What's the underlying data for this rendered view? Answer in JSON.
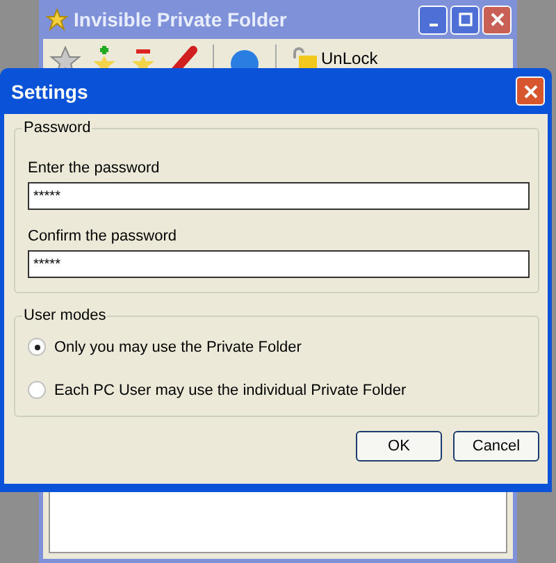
{
  "back_window": {
    "title": "Invisible Private Folder",
    "toolbar": {
      "unlock_label": "UnLock"
    }
  },
  "dialog": {
    "title": "Settings",
    "password_group": {
      "title": "Password",
      "fields": [
        {
          "label": "Enter the password",
          "value": "*****"
        },
        {
          "label": "Confirm the password",
          "value": "*****"
        }
      ]
    },
    "modes_group": {
      "title": "User modes",
      "options": [
        {
          "label": "Only you may use  the Private Folder",
          "selected": true
        },
        {
          "label": "Each PC User may use the individual Private Folder",
          "selected": false
        }
      ]
    },
    "buttons": [
      "OK",
      "Cancel"
    ]
  }
}
